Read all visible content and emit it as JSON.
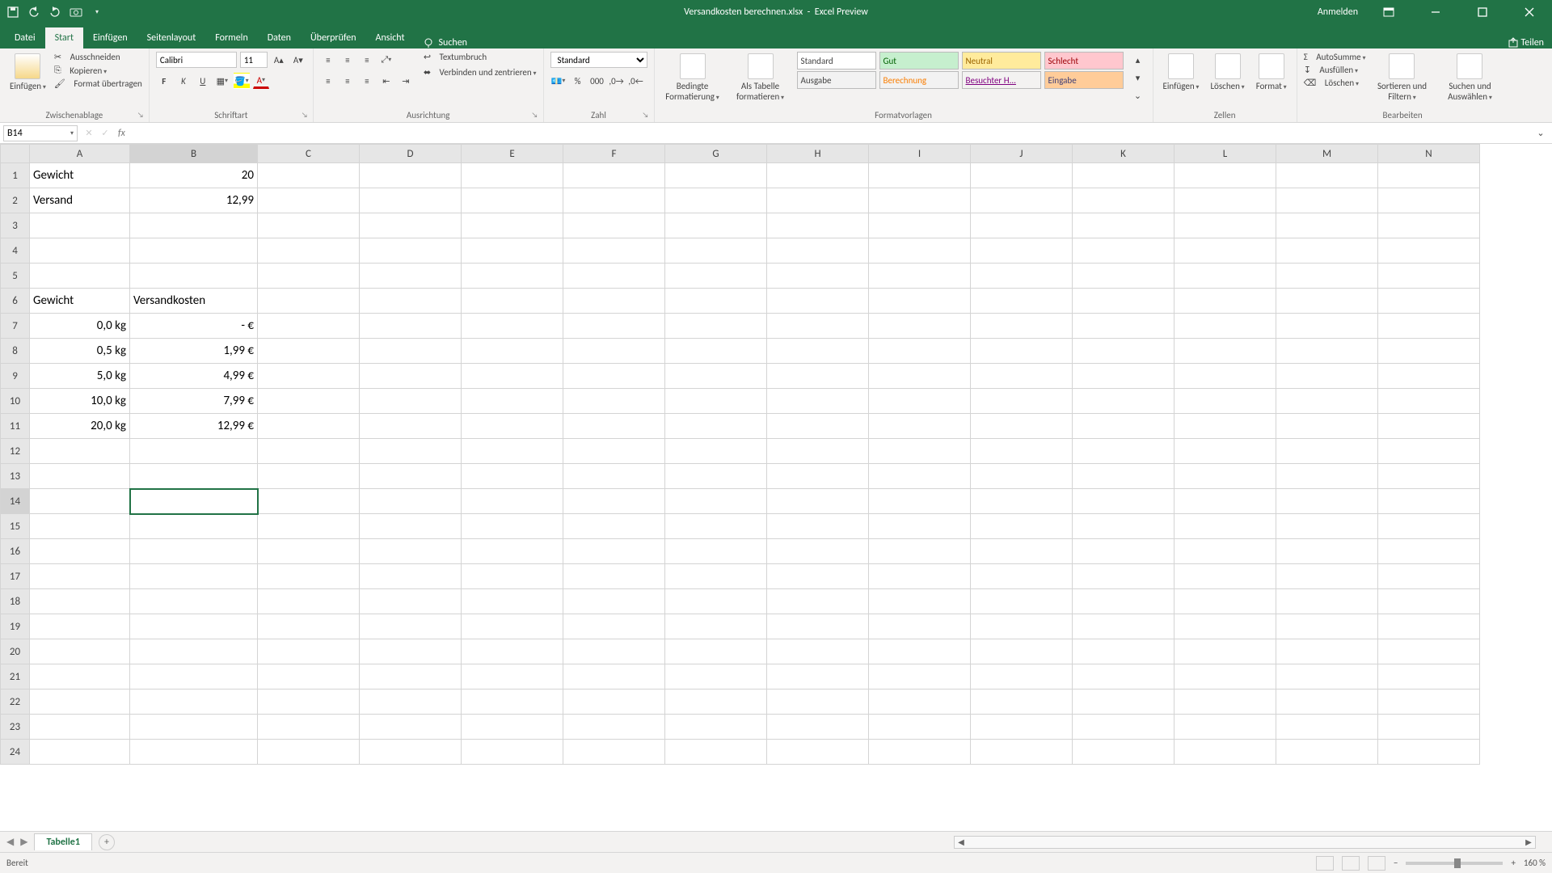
{
  "titlebar": {
    "filename": "Versandkosten berechnen.xlsx",
    "app": "Excel Preview",
    "signin": "Anmelden"
  },
  "tabs": {
    "datei": "Datei",
    "start": "Start",
    "einfuegen": "Einfügen",
    "seitenlayout": "Seitenlayout",
    "formeln": "Formeln",
    "daten": "Daten",
    "ueberpruefen": "Überprüfen",
    "ansicht": "Ansicht",
    "suchen": "Suchen",
    "teilen": "Teilen"
  },
  "ribbon": {
    "clipboard": {
      "paste": "Einfügen",
      "cut": "Ausschneiden",
      "copy": "Kopieren",
      "format_painter": "Format übertragen",
      "label": "Zwischenablage"
    },
    "font": {
      "name": "Calibri",
      "size": "11",
      "label": "Schriftart"
    },
    "align": {
      "wrap": "Textumbruch",
      "merge": "Verbinden und zentrieren",
      "label": "Ausrichtung"
    },
    "number": {
      "format": "Standard",
      "label": "Zahl"
    },
    "styles": {
      "cond": "Bedingte Formatierung",
      "astable": "Als Tabelle formatieren",
      "s1": "Standard",
      "s2": "Gut",
      "s3": "Neutral",
      "s4": "Schlecht",
      "s5": "Ausgabe",
      "s6": "Berechnung",
      "s7": "Besuchter H...",
      "s8": "Eingabe",
      "label": "Formatvorlagen"
    },
    "cells": {
      "insert": "Einfügen",
      "delete": "Löschen",
      "format": "Format",
      "label": "Zellen"
    },
    "editing": {
      "sum": "AutoSumme",
      "fill": "Ausfüllen",
      "clear": "Löschen",
      "sort": "Sortieren und Filtern",
      "find": "Suchen und Auswählen",
      "label": "Bearbeiten"
    }
  },
  "namebox": "B14",
  "columns": [
    "A",
    "B",
    "C",
    "D",
    "E",
    "F",
    "G",
    "H",
    "I",
    "J",
    "K",
    "L",
    "M",
    "N"
  ],
  "rows": [
    "1",
    "2",
    "3",
    "4",
    "5",
    "6",
    "7",
    "8",
    "9",
    "10",
    "11",
    "12",
    "13",
    "14",
    "15",
    "16",
    "17",
    "18",
    "19",
    "20",
    "21",
    "22",
    "23",
    "24"
  ],
  "cells": {
    "A1": "Gewicht",
    "B1": "20",
    "A2": "Versand",
    "B2": "12,99",
    "A6": "Gewicht",
    "B6": "Versandkosten",
    "A7": "0,0 kg",
    "B7": "-   €",
    "A8": "0,5 kg",
    "B8": "1,99 €",
    "A9": "5,0 kg",
    "B9": "4,99 €",
    "A10": "10,0 kg",
    "B10": "7,99 €",
    "A11": "20,0 kg",
    "B11": "12,99 €"
  },
  "selected": "B14",
  "sheettab": "Tabelle1",
  "status": {
    "ready": "Bereit",
    "zoom": "160 %"
  }
}
